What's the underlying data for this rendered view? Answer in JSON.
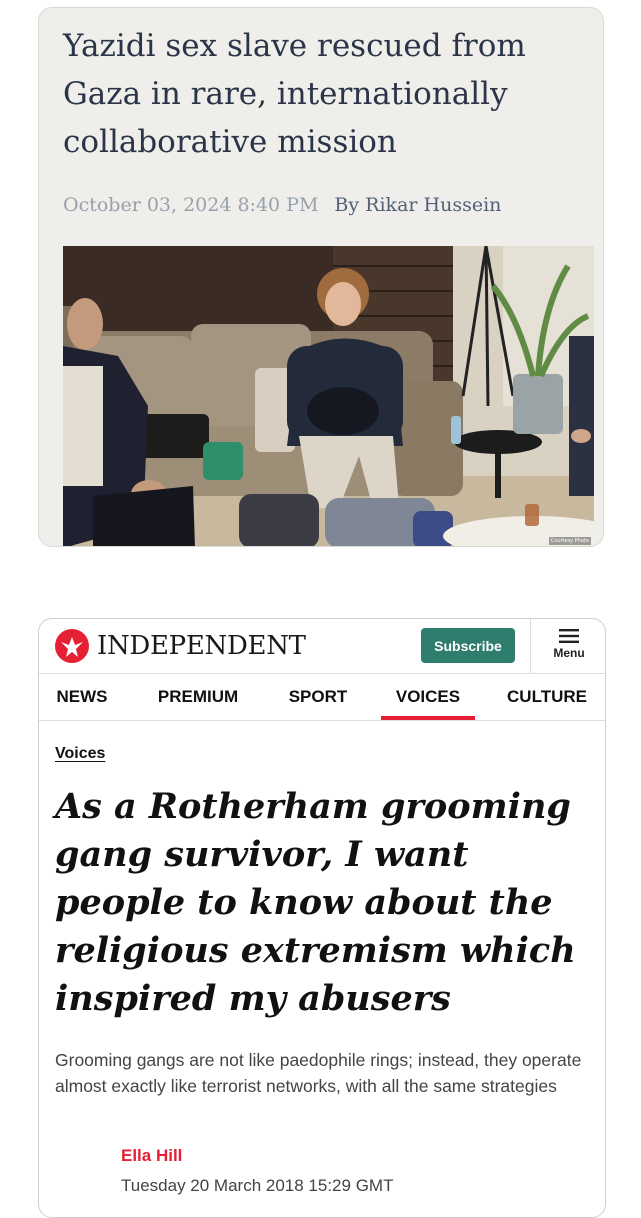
{
  "article1": {
    "headline": "Yazidi sex slave rescued from Gaza in rare, internationally collaborative mission",
    "date": "October 03, 2024 8:40 PM",
    "by_label": "By",
    "author": "Rikar Hussein",
    "photo_credit": "Courtesy Photo"
  },
  "article2": {
    "brand": "INDEPENDENT",
    "subscribe_label": "Subscribe",
    "menu_label": "Menu",
    "nav": [
      {
        "label": "NEWS"
      },
      {
        "label": "PREMIUM"
      },
      {
        "label": "SPORT"
      },
      {
        "label": "VOICES",
        "active": true
      },
      {
        "label": "CULTURE"
      }
    ],
    "section": "Voices",
    "headline": "As a Rotherham grooming gang survivor, I want people to know about the religious extremism which inspired my abusers",
    "standfirst": "Grooming gangs are not like paedophile rings; instead, they operate almost exactly like terrorist networks, with all the same strategies",
    "author": "Ella Hill",
    "date": "Tuesday 20 March 2018 15:29 GMT",
    "colors": {
      "accent": "#e52034",
      "subscribe": "#2e7d6f"
    }
  }
}
